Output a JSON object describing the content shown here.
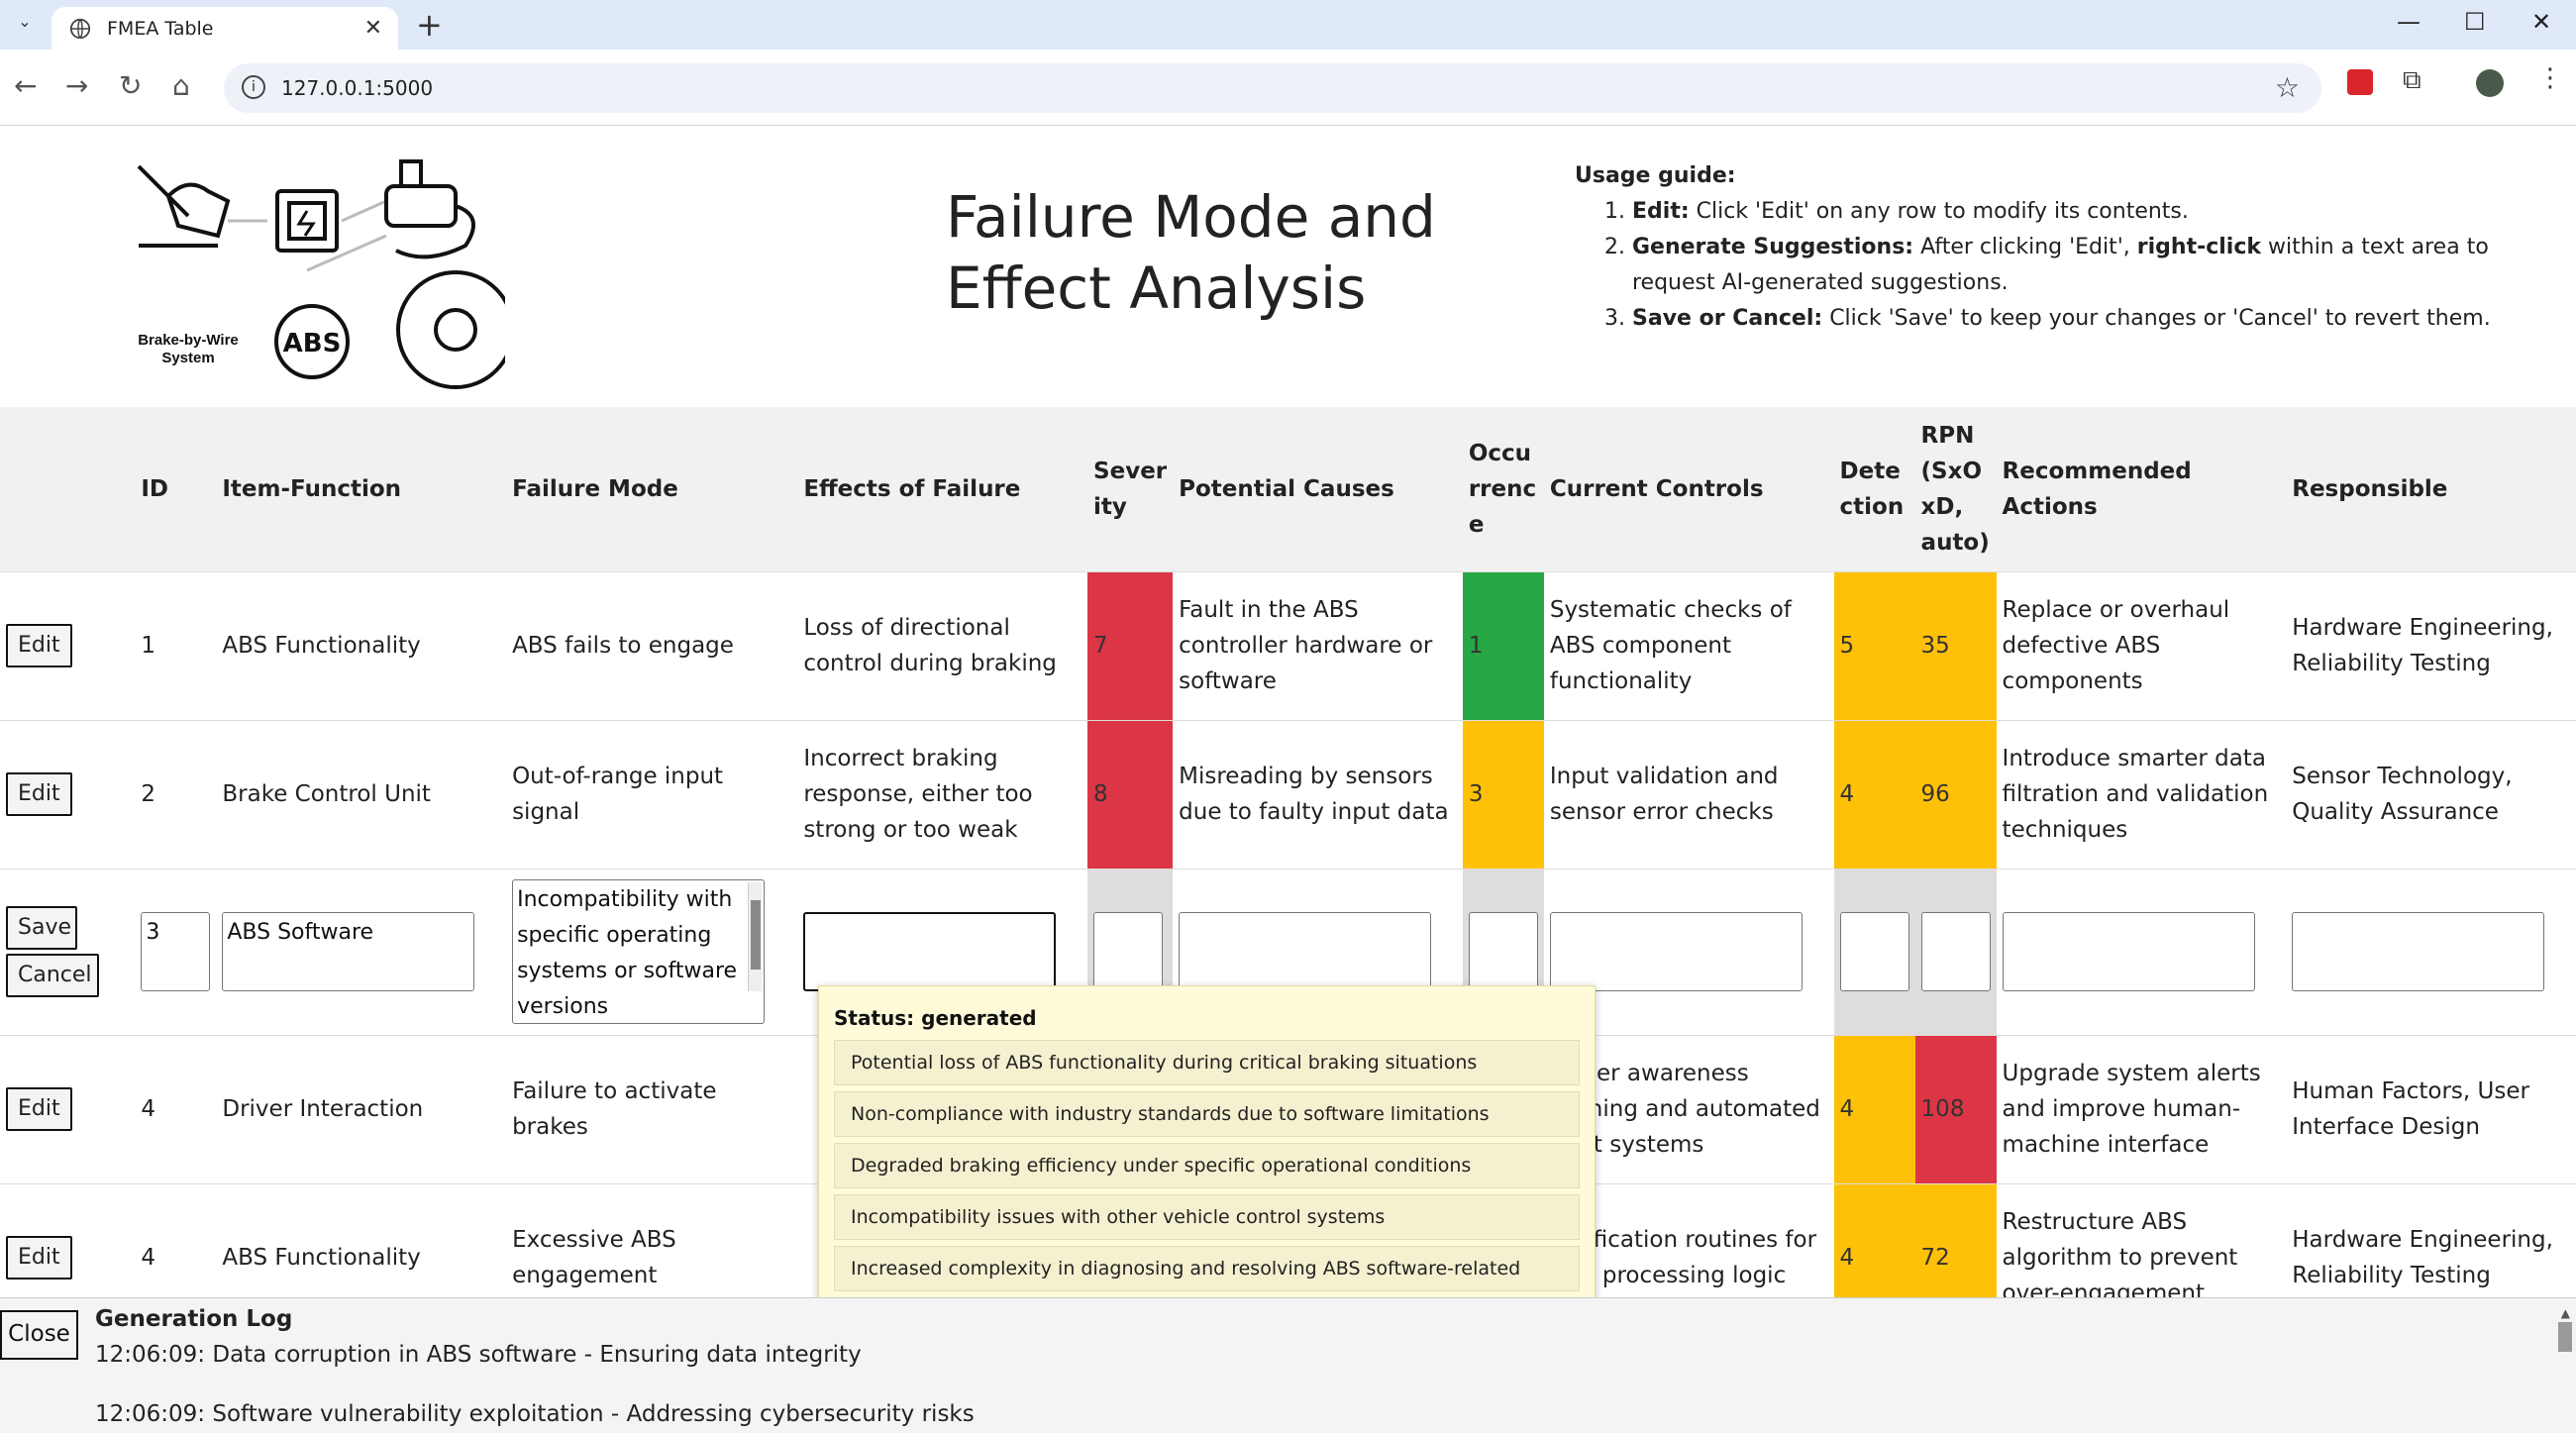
{
  "browser": {
    "tab_title": "FMEA Table",
    "url": "127.0.0.1:5000"
  },
  "page": {
    "logo_caption_line1": "Brake-by-Wire",
    "logo_caption_line2": "System",
    "logo_abs_text": "ABS",
    "title_line1": "Failure Mode and",
    "title_line2": "Effect Analysis",
    "guide": {
      "heading": "Usage guide:",
      "items": [
        {
          "bold": "Edit:",
          "text": " Click 'Edit' on any row to modify its contents."
        },
        {
          "bold": "Generate Suggestions:",
          "text": " After clicking 'Edit', ",
          "bold2": "right-click",
          "text2": " within a text area to request AI-generated suggestions."
        },
        {
          "bold": "Save or Cancel:",
          "text": " Click 'Save' to keep your changes or 'Cancel' to revert them."
        }
      ]
    }
  },
  "table": {
    "headers": {
      "id": "ID",
      "item": "Item-Function",
      "failure_mode": "Failure Mode",
      "effects": "Effects of Failure",
      "severity": "Sever ity",
      "causes": "Potential Causes",
      "occurrence": "Occu rrenc e",
      "controls": "Current Controls",
      "detection": "Dete ction",
      "rpn": "RPN (SxO xD, auto)",
      "actions": "Recommended Actions",
      "responsible": "Responsible"
    },
    "rows": [
      {
        "button": "Edit",
        "id": "1",
        "item": "ABS Functionality",
        "failure_mode": "ABS fails to engage",
        "effects": "Loss of directional control during braking",
        "severity": "7",
        "causes": "Fault in the ABS controller hardware or software",
        "occurrence": "1",
        "controls": "Systematic checks of ABS component functionality",
        "detection": "5",
        "rpn": "35",
        "actions": "Replace or overhaul defective ABS components",
        "responsible": "Hardware Engineering, Reliability Testing"
      },
      {
        "button": "Edit",
        "id": "2",
        "item": "Brake Control Unit",
        "failure_mode": "Out-of-range input signal",
        "effects": "Incorrect braking response, either too strong or too weak",
        "severity": "8",
        "causes": "Misreading by sensors due to faulty input data",
        "occurrence": "3",
        "controls": "Input validation and sensor error checks",
        "detection": "4",
        "rpn": "96",
        "actions": "Introduce smarter data filtration and validation techniques",
        "responsible": "Sensor Technology, Quality Assurance"
      },
      {
        "button": "Edit",
        "id": "4",
        "item": "Driver Interaction",
        "failure_mode": "Failure to activate brakes",
        "effects": "",
        "severity": "",
        "causes": "",
        "occurrence": "",
        "controls": "Driver awareness training and automated alert systems",
        "detection": "4",
        "rpn": "108",
        "actions": "Upgrade system alerts and improve human-machine interface",
        "responsible": "Human Factors, User Interface Design"
      },
      {
        "button": "Edit",
        "id": "4",
        "item": "ABS Functionality",
        "failure_mode": "Excessive ABS engagement",
        "effects": "",
        "severity": "",
        "causes": "",
        "occurrence": "",
        "controls": "Verification routines for ABS processing logic",
        "detection": "4",
        "rpn": "72",
        "actions": "Restructure ABS algorithm to prevent over-engagement",
        "responsible": "Hardware Engineering, Reliability Testing"
      }
    ],
    "edit_row": {
      "save_label": "Save",
      "cancel_label": "Cancel",
      "id_value": "3",
      "item_value": "ABS Software",
      "failure_mode_value": "Incompatibility with specific operating systems or software versions"
    }
  },
  "suggestions": {
    "status": "Status: generated",
    "items": [
      "Potential loss of ABS functionality during critical braking situations",
      "Non-compliance with industry standards due to software limitations",
      "Degraded braking efficiency under specific operational conditions",
      "Incompatibility issues with other vehicle control systems",
      "Increased complexity in diagnosing and resolving ABS software-related faults"
    ]
  },
  "log": {
    "close_label": "Close",
    "title": "Generation Log",
    "entries": [
      "12:06:09: Data corruption in ABS software - Ensuring data integrity",
      "12:06:09: Software vulnerability exploitation - Addressing cybersecurity risks"
    ]
  },
  "colors": {
    "red": "#dc3545",
    "green": "#28a745",
    "yellow": "#ffc107",
    "header_bg": "#f1f1f1",
    "popup_bg": "#fffbd9"
  }
}
